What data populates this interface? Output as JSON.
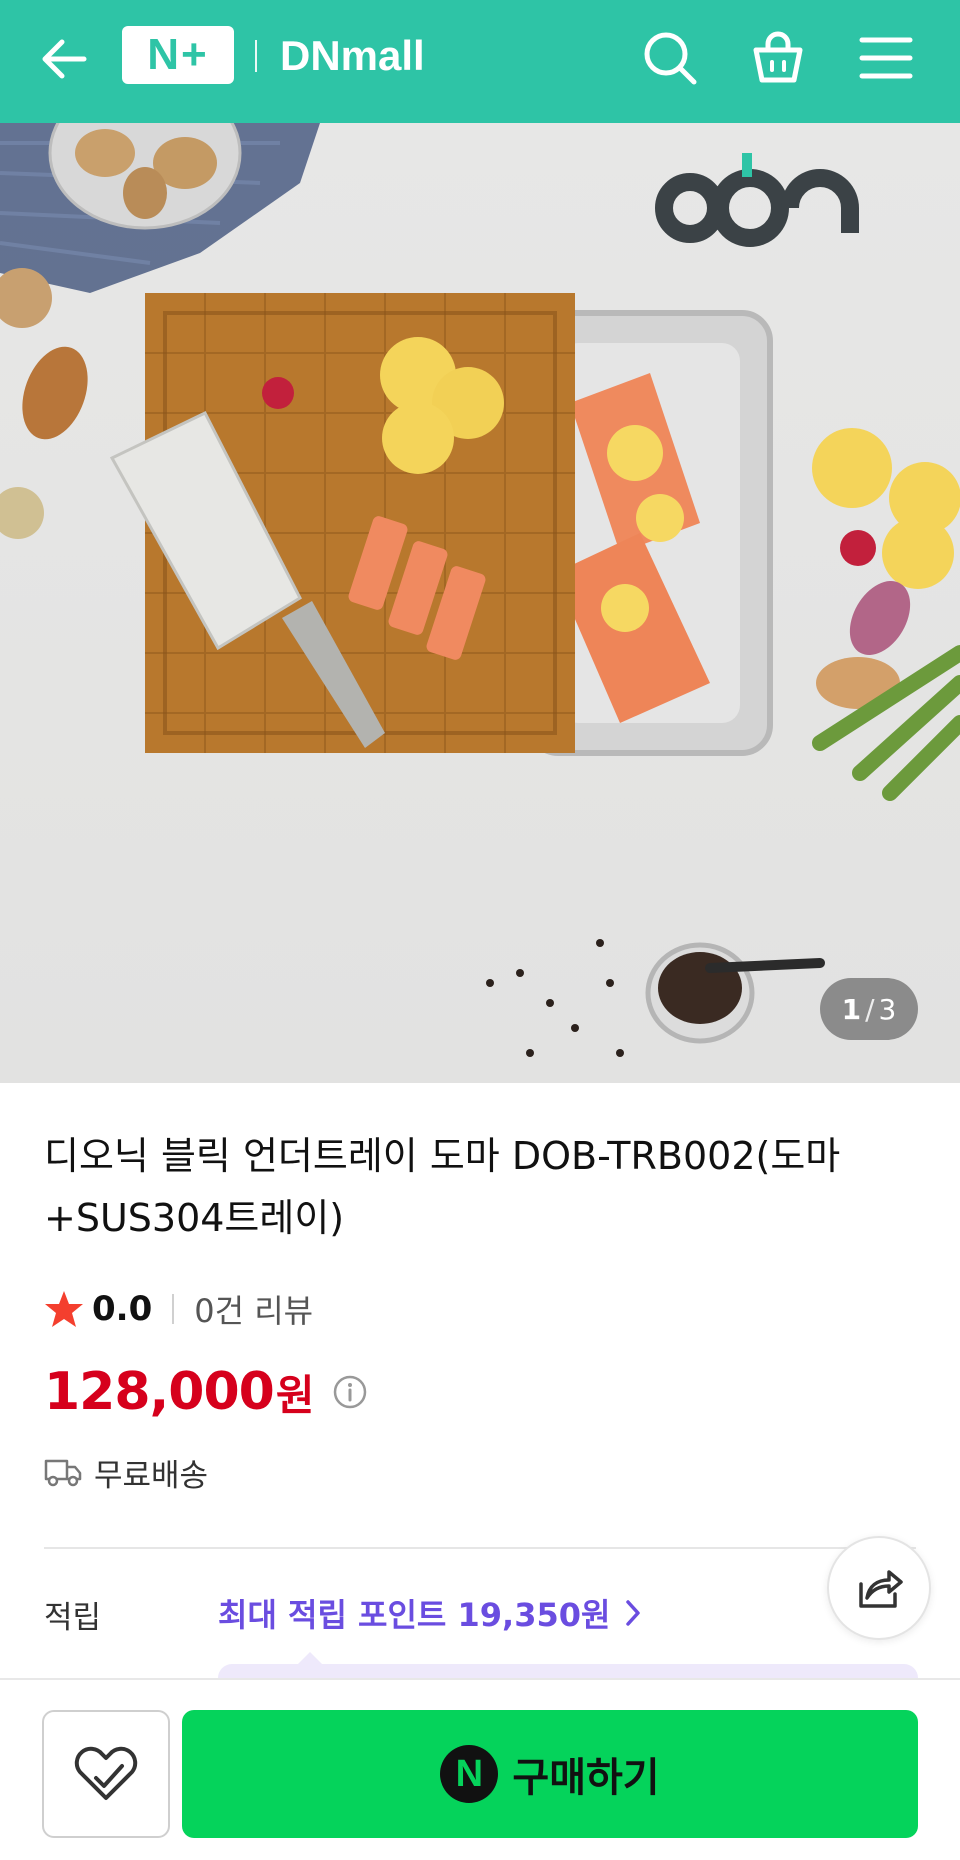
{
  "header": {
    "logo_text": "N+",
    "brand": "DNmall",
    "bg_color": "#2ec4a6"
  },
  "gallery": {
    "current": "1",
    "separator": "/",
    "total": "3"
  },
  "product": {
    "title": "디오닉 블릭 언더트레이 도마 DOB-TRB002(도마+SUS304트레이)",
    "rating": "0.0",
    "review_count": "0건 리뷰",
    "price": "128,000",
    "currency": "원",
    "shipping": "무료배송",
    "price_color": "#d6001c"
  },
  "points": {
    "label": "적립",
    "link_text": "최대 적립 포인트 19,350원"
  },
  "bottom_bar": {
    "buy_badge": "N",
    "buy_label": "구매하기",
    "buy_color": "#05d35b"
  },
  "icons": [
    "back-arrow-icon",
    "search-icon",
    "shopping-bag-icon",
    "menu-icon",
    "star-icon",
    "info-icon",
    "truck-icon",
    "chevron-right-icon",
    "share-icon",
    "heart-check-icon"
  ]
}
